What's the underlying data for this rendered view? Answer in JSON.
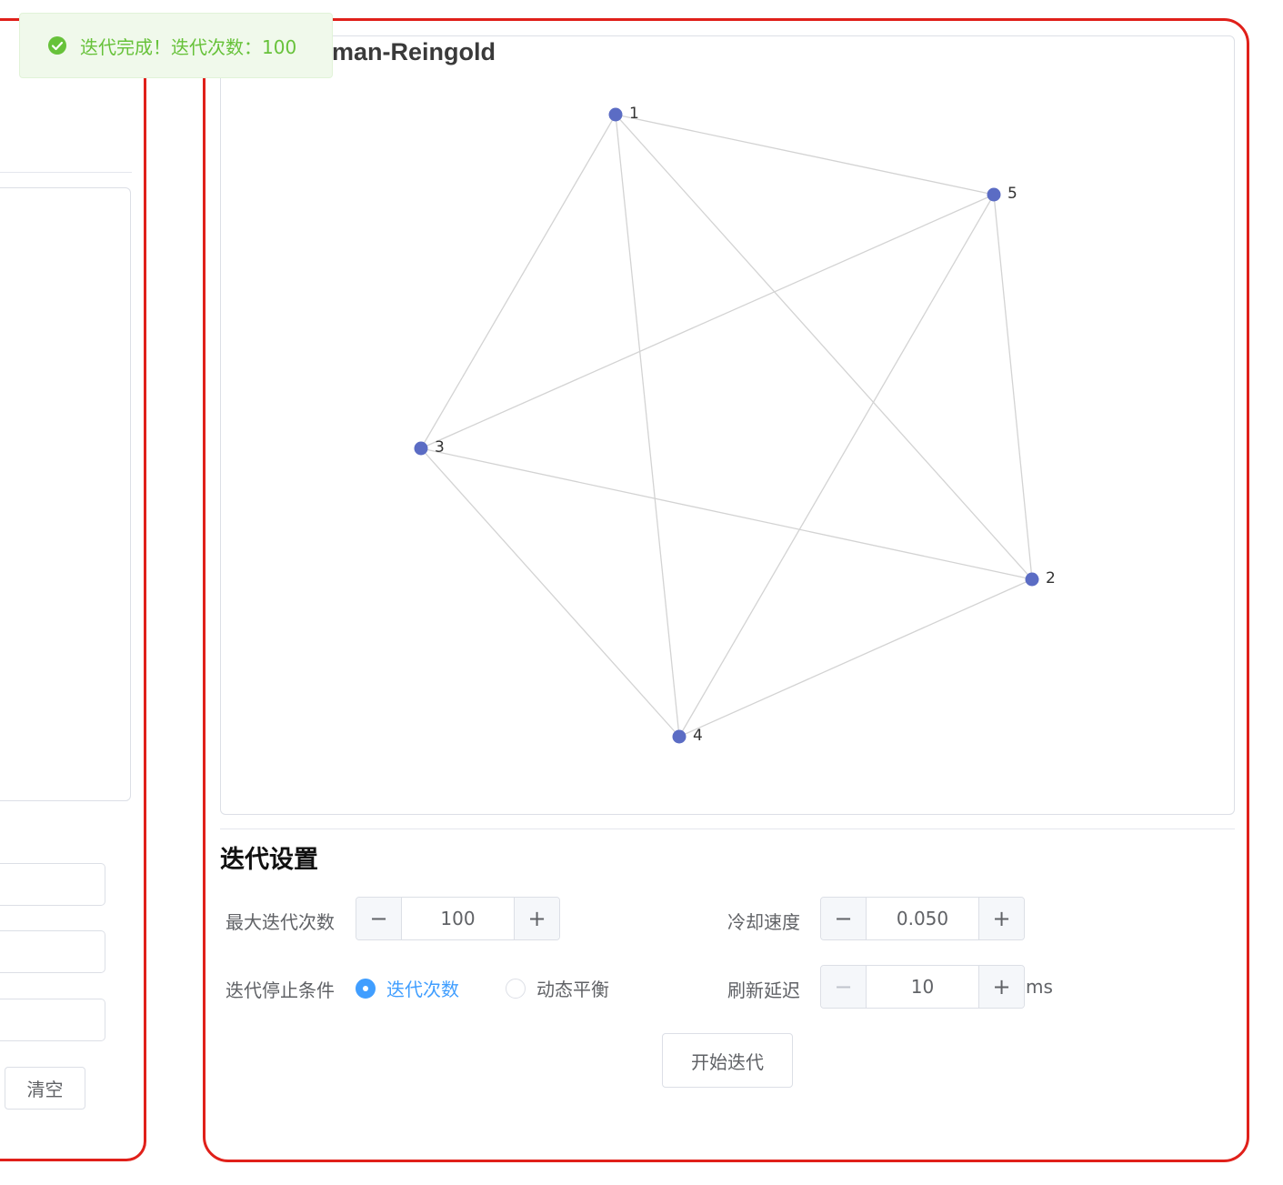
{
  "toast": {
    "message": "迭代完成！迭代次数：100",
    "icon": "success-check-icon",
    "color": "#67c23a"
  },
  "left_panel": {
    "clear_label": "清空"
  },
  "graph": {
    "title": "Fruchterman-Reingold",
    "visible_title": "man-Reingold",
    "node_color": "#5b6cc4",
    "edge_color": "#d3d3d3",
    "nodes": [
      {
        "id": "1",
        "label": "1"
      },
      {
        "id": "2",
        "label": "2"
      },
      {
        "id": "3",
        "label": "3"
      },
      {
        "id": "4",
        "label": "4"
      },
      {
        "id": "5",
        "label": "5"
      }
    ],
    "edges": [
      [
        "1",
        "5"
      ],
      [
        "1",
        "3"
      ],
      [
        "1",
        "2"
      ],
      [
        "1",
        "4"
      ],
      [
        "5",
        "3"
      ],
      [
        "5",
        "4"
      ],
      [
        "5",
        "2"
      ],
      [
        "3",
        "2"
      ],
      [
        "3",
        "4"
      ],
      [
        "4",
        "2"
      ]
    ]
  },
  "settings": {
    "title": "迭代设置",
    "max_iter": {
      "label": "最大迭代次数",
      "value": "100",
      "minus": "−",
      "plus": "+"
    },
    "cooling": {
      "label": "冷却速度",
      "value": "0.050",
      "minus": "−",
      "plus": "+"
    },
    "stop_condition": {
      "label": "迭代停止条件",
      "options": [
        {
          "label": "迭代次数",
          "checked": true
        },
        {
          "label": "动态平衡",
          "checked": false
        }
      ]
    },
    "refresh_delay": {
      "label": "刷新延迟",
      "value": "10",
      "unit": "ms",
      "minus": "−",
      "plus": "+"
    },
    "start_label": "开始迭代"
  },
  "colors": {
    "accent": "#409eff",
    "panel_border": "#e0201a"
  }
}
